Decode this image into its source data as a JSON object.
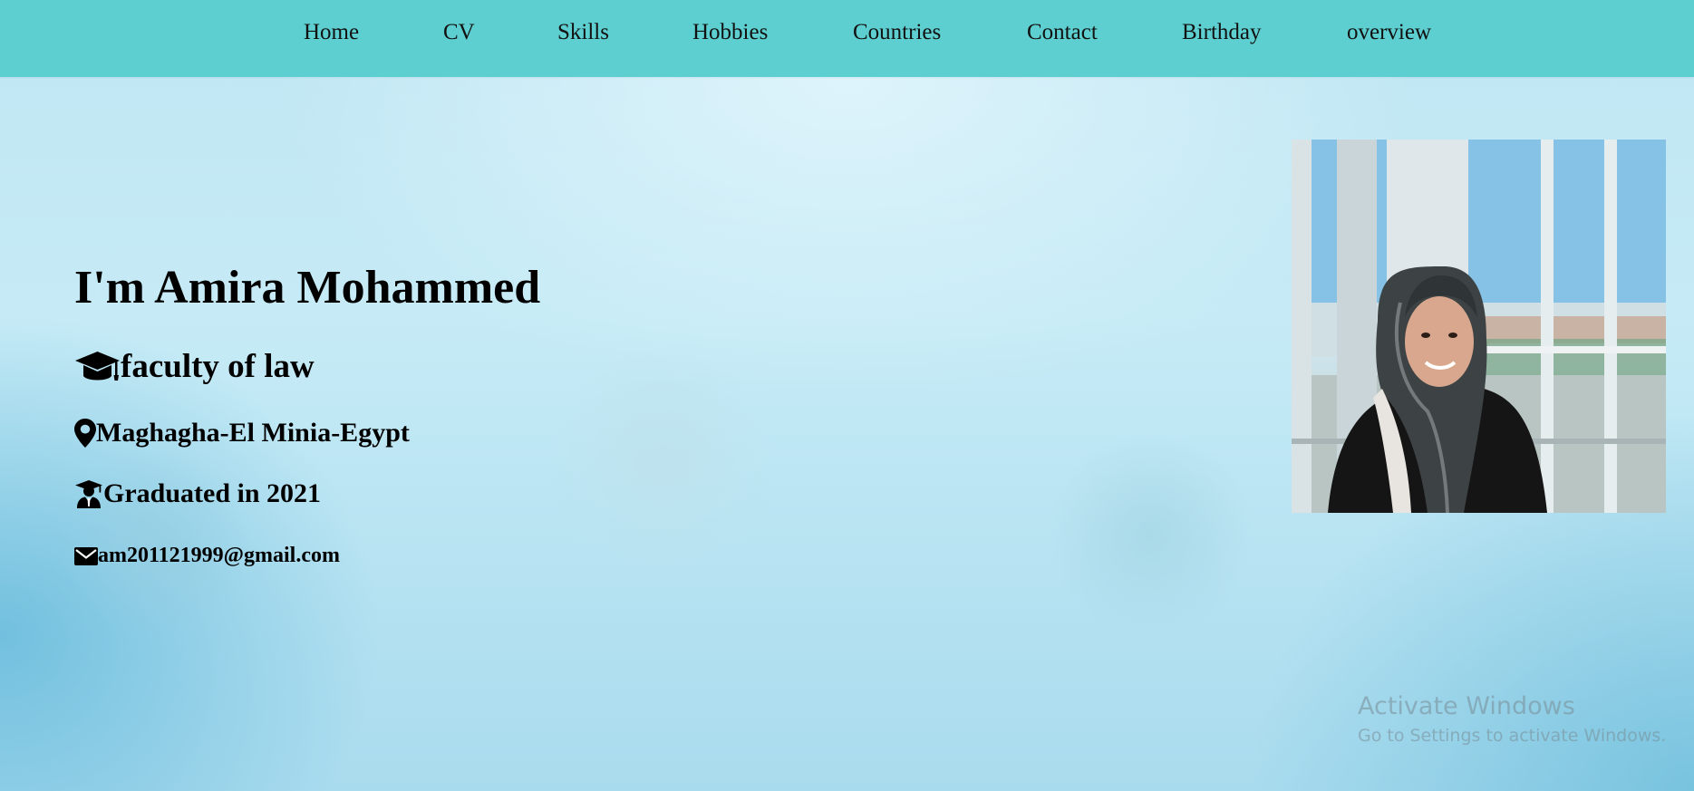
{
  "nav": {
    "items": [
      {
        "label": "Home"
      },
      {
        "label": "CV"
      },
      {
        "label": "Skills"
      },
      {
        "label": "Hobbies"
      },
      {
        "label": "Countries"
      },
      {
        "label": "Contact"
      },
      {
        "label": "Birthday"
      },
      {
        "label": "overview"
      }
    ]
  },
  "profile": {
    "title": "I'm Amira Mohammed",
    "faculty": "faculty of law",
    "location": "Maghagha-El Minia-Egypt",
    "graduation": "Graduated in 2021",
    "email": "am201121999@gmail.com"
  },
  "icons": {
    "faculty": "graduation-cap-icon",
    "location": "map-marker-icon",
    "graduation": "user-graduate-icon",
    "email": "envelope-icon"
  },
  "watermark": {
    "title": "Activate Windows",
    "subtitle": "Go to Settings to activate Windows."
  },
  "colors": {
    "navbar": "#5ecfd0",
    "background": "#c6ebf6",
    "text": "#000000"
  }
}
